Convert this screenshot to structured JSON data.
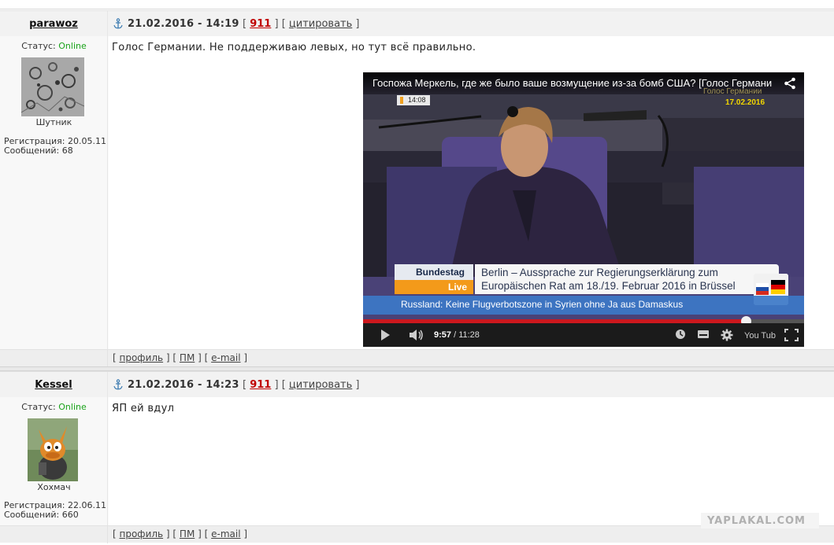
{
  "posts": [
    {
      "username": "parawoz",
      "datetime": "21.02.2016 - 14:19",
      "post_num": "911",
      "quote_label": "цитировать",
      "status_label": "Статус:",
      "status_value": "Online",
      "rank": "Шутник",
      "registration": "Регистрация: 20.05.11",
      "messages": "Сообщений: 68",
      "text": "Голос Германии. Не поддерживаю левых, но тут всё правильно.",
      "footer": {
        "profile": "профиль",
        "pm": "ПМ",
        "email": "e-mail"
      },
      "video": {
        "title": "Госпожа Меркель, где же было ваше возмущение из-за бомб США? [Голос Германи",
        "watermark": "Голос Германии",
        "date_overlay": "17.02.2016",
        "clock": "14:08",
        "lower_third_brand": "Bundestag",
        "lower_third_live": "Live",
        "headline_line1": "Berlin – Aussprache zur Regierungserklärung zum",
        "headline_line2": "Europäischen Rat am 18./19. Februar 2016 in Brüssel",
        "ticker": "Russland: Keine Flugverbotszone in Syrien ohne Ja aus Damaskus",
        "current_time": "9:57",
        "duration": "/ 11:28",
        "progress": 0.868,
        "youtube_logo": "You Tube"
      }
    },
    {
      "username": "Kessel",
      "datetime": "21.02.2016 - 14:23",
      "post_num": "911",
      "quote_label": "цитировать",
      "status_label": "Статус:",
      "status_value": "Online",
      "rank": "Хохмач",
      "registration": "Регистрация: 22.06.11",
      "messages": "Сообщений: 660",
      "text": "ЯП ей вдул",
      "footer": {
        "profile": "профиль",
        "pm": "ПМ",
        "email": "e-mail"
      }
    }
  ],
  "site_watermark": "YAPLAKAL.COM",
  "colors": {
    "online": "#1aa31a",
    "post_num": "#c00000",
    "progress": "#cc181e"
  }
}
